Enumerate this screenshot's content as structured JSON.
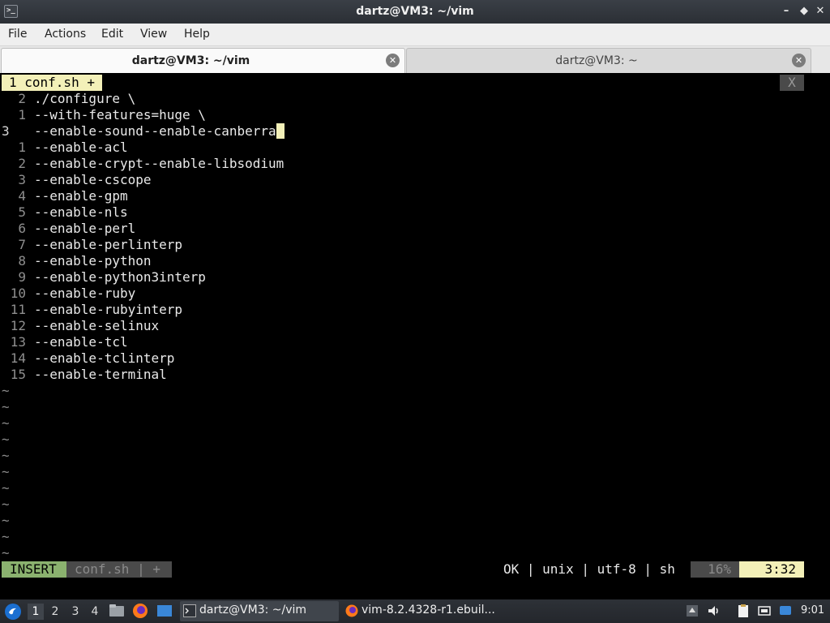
{
  "window": {
    "title": "dartz@VM3: ~/vim",
    "controls": [
      "minimize",
      "maximize",
      "close"
    ]
  },
  "menu": [
    "File",
    "Actions",
    "Edit",
    "View",
    "Help"
  ],
  "tabs": [
    {
      "label": "dartz@VM3: ~/vim",
      "active": true
    },
    {
      "label": "dartz@VM3: ~",
      "active": false
    }
  ],
  "vim": {
    "tabline": {
      "active_tab": "1 conf.sh +",
      "close": "X"
    },
    "lines": [
      {
        "num": "2",
        "text": "./configure \\"
      },
      {
        "num": "1",
        "text": "--with-features=huge \\"
      },
      {
        "num": "3",
        "text": "--enable-sound--enable-canberra",
        "current": true
      },
      {
        "num": "1",
        "text": "--enable-acl"
      },
      {
        "num": "2",
        "text": "--enable-crypt--enable-libsodium"
      },
      {
        "num": "3",
        "text": "--enable-cscope"
      },
      {
        "num": "4",
        "text": "--enable-gpm"
      },
      {
        "num": "5",
        "text": "--enable-nls"
      },
      {
        "num": "6",
        "text": "--enable-perl"
      },
      {
        "num": "7",
        "text": "--enable-perlinterp"
      },
      {
        "num": "8",
        "text": "--enable-python"
      },
      {
        "num": "9",
        "text": "--enable-python3interp"
      },
      {
        "num": "10",
        "text": "--enable-ruby"
      },
      {
        "num": "11",
        "text": "--enable-rubyinterp"
      },
      {
        "num": "12",
        "text": "--enable-selinux"
      },
      {
        "num": "13",
        "text": "--enable-tcl"
      },
      {
        "num": "14",
        "text": "--enable-tclinterp"
      },
      {
        "num": "15",
        "text": "--enable-terminal"
      }
    ],
    "tilde_count": 11,
    "tilde": "~",
    "statusline": {
      "mode": "INSERT",
      "file": "conf.sh | +",
      "info": "OK | unix | utf-8 | sh",
      "percent": "16%",
      "position": "3:32"
    }
  },
  "taskbar": {
    "workspaces": [
      "1",
      "2",
      "3",
      "4"
    ],
    "active_workspace": "1",
    "tasks": [
      {
        "label": "dartz@VM3: ~/vim",
        "icon": "terminal-icon",
        "active": true
      },
      {
        "label": "vim-8.2.4328-r1.ebuil...",
        "icon": "firefox-icon",
        "active": false
      }
    ],
    "clock": "9:01"
  },
  "colors": {
    "vim_highlight": "#f3f0b8",
    "vim_insert": "#8bb26f",
    "vim_gray": "#4a4a4a"
  }
}
